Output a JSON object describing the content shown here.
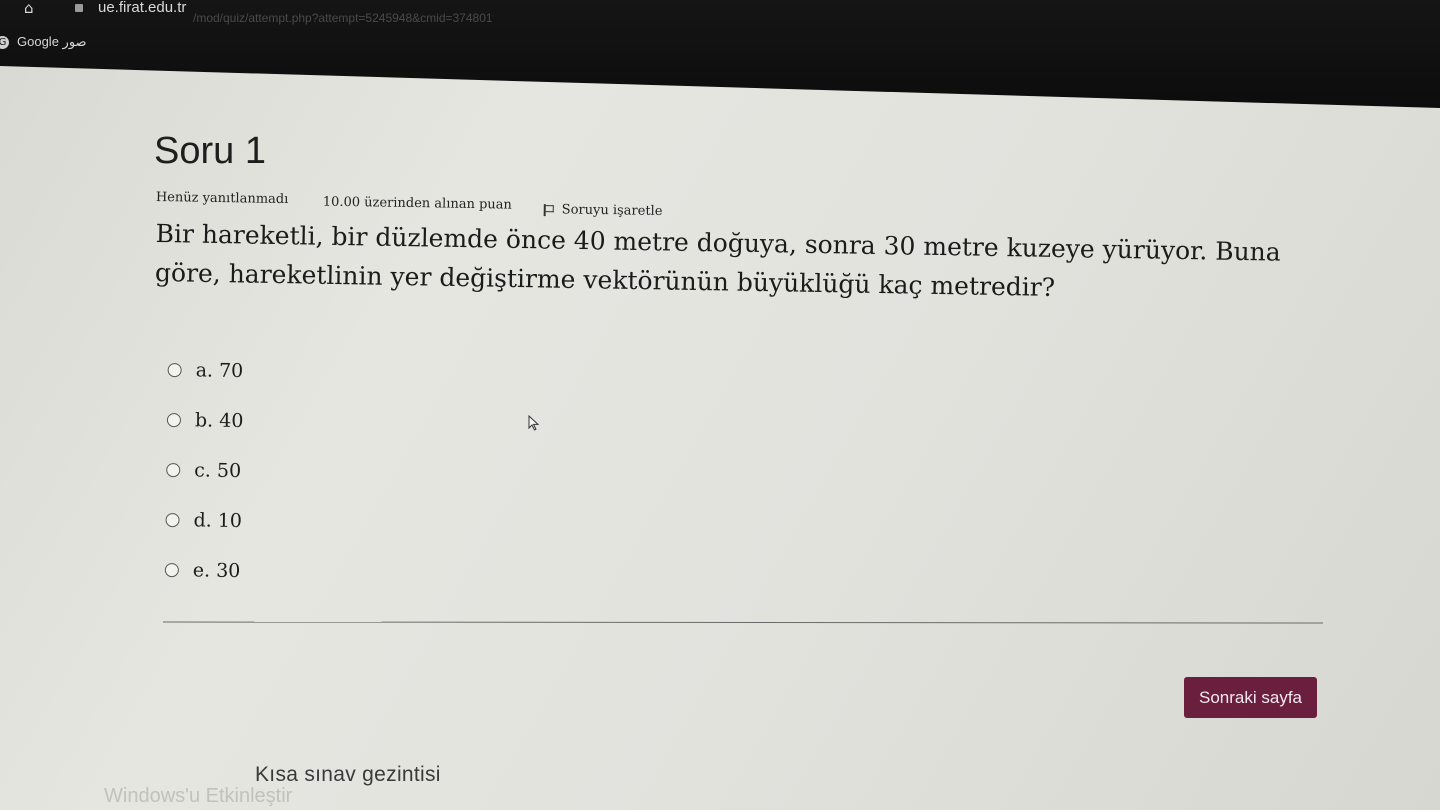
{
  "browser": {
    "url_host": "ue.firat.edu.tr",
    "url_path": "/mod/quiz/attempt.php?attempt=5245948&cmid=374801",
    "bookmark_label": "Google صور"
  },
  "question": {
    "title": "Soru 1",
    "status": "Henüz yanıtlanmadı",
    "points": "10.00 üzerinden alınan puan",
    "flag_label": "Soruyu işaretle",
    "text": "Bir hareketli, bir düzlemde önce 40 metre doğuya, sonra 30 metre kuzeye yürüyor. Buna göre, hareketlinin yer değiştirme vektörünün büyüklüğü kaç metredir?",
    "answers": [
      {
        "label": "a. 70"
      },
      {
        "label": "b. 40"
      },
      {
        "label": "c. 50"
      },
      {
        "label": "d. 10"
      },
      {
        "label": "e. 30"
      }
    ]
  },
  "actions": {
    "next_label": "Sonraki sayfa"
  },
  "footer": {
    "nav_label": "Kısa sınav gezintisi",
    "watermark": "Windows'u Etkinleştir"
  },
  "colors": {
    "button_bg": "#6b1f3f",
    "page_bg": "#e2e2dd"
  }
}
